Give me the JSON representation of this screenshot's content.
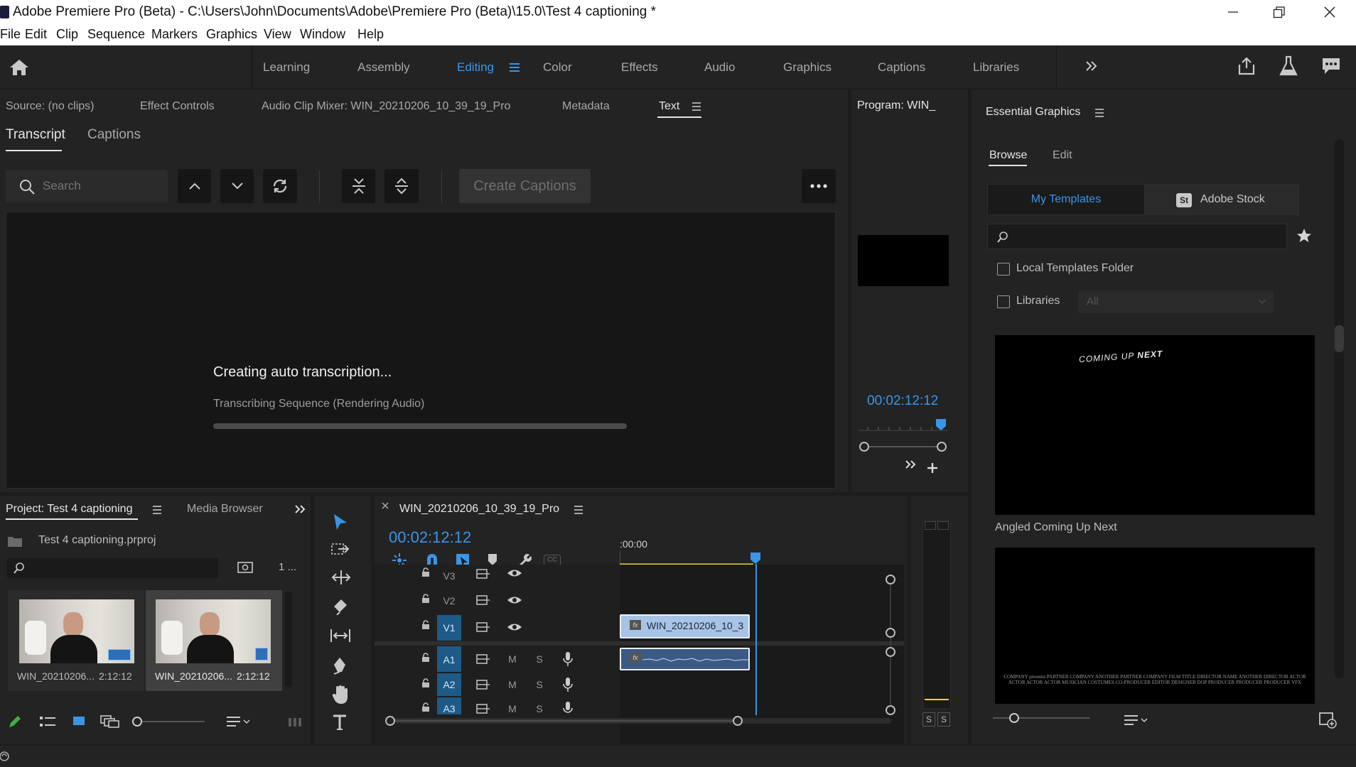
{
  "window": {
    "title": "Adobe Premiere Pro (Beta) - C:\\Users\\John\\Documents\\Adobe\\Premiere Pro (Beta)\\15.0\\Test 4 captioning *"
  },
  "menu": [
    "File",
    "Edit",
    "Clip",
    "Sequence",
    "Markers",
    "Graphics",
    "View",
    "Window",
    "Help"
  ],
  "workspaces": {
    "tabs": [
      "Learning",
      "Assembly",
      "Editing",
      "Color",
      "Effects",
      "Audio",
      "Graphics",
      "Captions",
      "Libraries"
    ],
    "active": "Editing"
  },
  "source_panel": {
    "tabs": [
      "Source: (no clips)",
      "Effect Controls",
      "Audio Clip Mixer: WIN_20210206_10_39_19_Pro",
      "Metadata",
      "Text"
    ],
    "active_tab": "Text",
    "subtabs": [
      "Transcript",
      "Captions"
    ],
    "active_subtab": "Transcript",
    "search_placeholder": "Search",
    "create_captions_label": "Create Captions",
    "status_title": "Creating auto transcription...",
    "status_detail": "Transcribing Sequence (Rendering Audio)",
    "progress": 0
  },
  "program_panel": {
    "title": "Program: WIN_",
    "timecode": "00:02:12:12"
  },
  "essential_graphics": {
    "title": "Essential Graphics",
    "tabs": [
      "Browse",
      "Edit"
    ],
    "active_tab": "Browse",
    "source_buttons": [
      "My Templates",
      "Adobe Stock"
    ],
    "stock_badge": "St",
    "filters": [
      {
        "label": "Local Templates Folder",
        "checked": false
      },
      {
        "label": "Libraries",
        "checked": false
      }
    ],
    "libraries_dropdown": "All",
    "templates": [
      {
        "name": "Angled Coming Up Next",
        "preview_text_a": "COMING UP",
        "preview_text_b": "NEXT"
      },
      {
        "name": "",
        "preview_credits": "COMPANY presents  PARTNER COMPANY  ANOTHER PARTNER COMPANY  FILM TITLE  DIRECTOR NAME  ANOTHER DIRECTOR  ACTOR ACTOR ACTOR ACTOR  MUSICIAN  COSTUMES  CO-PRODUCER  EDITOR  DESIGNER  DOP  PRODUCER PRODUCER PRODUCER  VFX"
      }
    ]
  },
  "project_panel": {
    "tabs": [
      "Project: Test 4 captioning",
      "Media Browser"
    ],
    "active_tab": "Project: Test 4 captioning",
    "project_file": "Test 4 captioning.prproj",
    "item_count": "1 ...",
    "clips": [
      {
        "name": "WIN_20210206...",
        "duration": "2:12:12",
        "selected": false
      },
      {
        "name": "WIN_20210206...",
        "duration": "2:12:12",
        "selected": true
      }
    ]
  },
  "timeline": {
    "sequence_name": "WIN_20210206_10_39_19_Pro",
    "timecode": "00:02:12:12",
    "ruler_start": ":00:00",
    "cc_label": "CC",
    "video_tracks": [
      "V3",
      "V2",
      "V1"
    ],
    "audio_tracks": [
      "A1",
      "A2",
      "A3"
    ],
    "track_buttons": {
      "mute": "M",
      "solo": "S"
    },
    "clip_name": "WIN_20210206_10_3",
    "fx_label": "fx"
  },
  "audio_meter": {
    "solo_labels": [
      "S",
      "S"
    ]
  },
  "colors": {
    "accent_blue": "#3b95e6",
    "timeline_clip": "#a7c3e6",
    "work_area": "#e7d52d",
    "track_target": "#1e5a87"
  }
}
